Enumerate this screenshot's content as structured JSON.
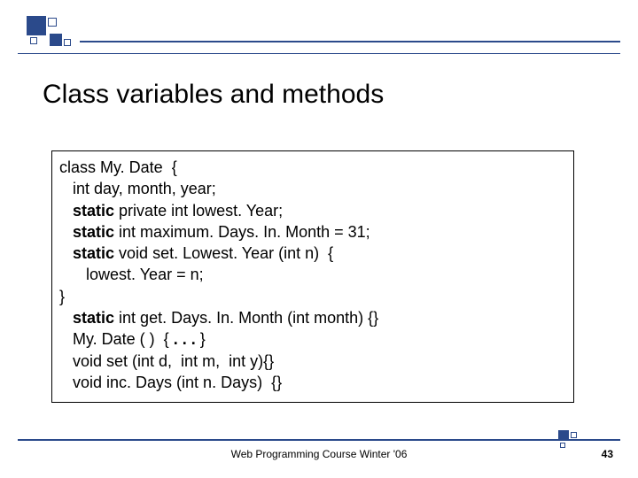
{
  "title": "Class variables and methods",
  "code": {
    "l0a": "class My. Date  {",
    "l1a": "   int day, month, year;",
    "l2a": "   ",
    "l2b": "static",
    "l2c": " private int lowest. Year;",
    "l3a": "   ",
    "l3b": "static",
    "l3c": " int maximum. Days. In. Month = 31;",
    "l4a": "   ",
    "l4b": "static",
    "l4c": " void set. Lowest. Year (int n)  {",
    "l5a": "      lowest. Year = n;",
    "l6a": "}",
    "l7a": "   ",
    "l7b": "static",
    "l7c": " int get. Days. In. Month (int month) {}",
    "l8a": "   My. Date ( )  { ",
    "l8b": ". . . ",
    "l8c": "}",
    "l9a": "   void set (int d,  int m,  int y){}",
    "l10a": "   void inc. Days (int n. Days)  {}"
  },
  "footer": "Web Programming Course Winter '06",
  "page": "43"
}
